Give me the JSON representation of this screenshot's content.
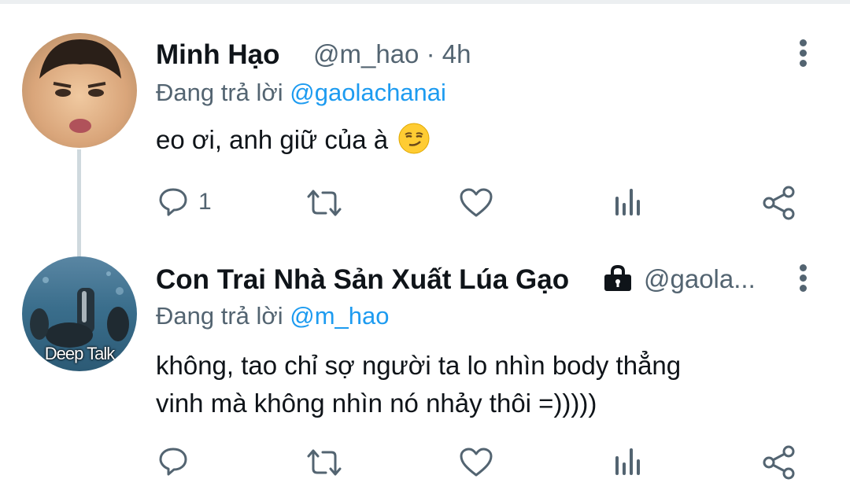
{
  "tweets": [
    {
      "name": "Minh Hạo",
      "handle": "@m_hao",
      "separator": "·",
      "time": "4h",
      "replying_prefix": "Đang trả lời",
      "replying_to": "@gaolachanai",
      "text": "eo ơi, anh giữ của à",
      "emoji": "smirking-face",
      "reply_count": "1"
    },
    {
      "name": "Con Trai Nhà Sản Xuất Lúa Gạo",
      "locked_icon": "lock-icon",
      "handle": "@gaola...",
      "avatar_caption": "Deep Talk",
      "replying_prefix": "Đang trả lời",
      "replying_to": "@m_hao",
      "text_line1": "không, tao chỉ sợ người ta lo nhìn body thẳng",
      "text_line2": "vinh mà không nhìn nó nhảy thôi =)))))",
      "reply_count": ""
    }
  ],
  "colors": {
    "text": "#0f1419",
    "muted": "#536471",
    "link": "#1d9bf0",
    "thread_line": "#cfd9de"
  },
  "icons": [
    "reply-icon",
    "retweet-icon",
    "like-icon",
    "analytics-icon",
    "share-icon",
    "more-icon"
  ]
}
